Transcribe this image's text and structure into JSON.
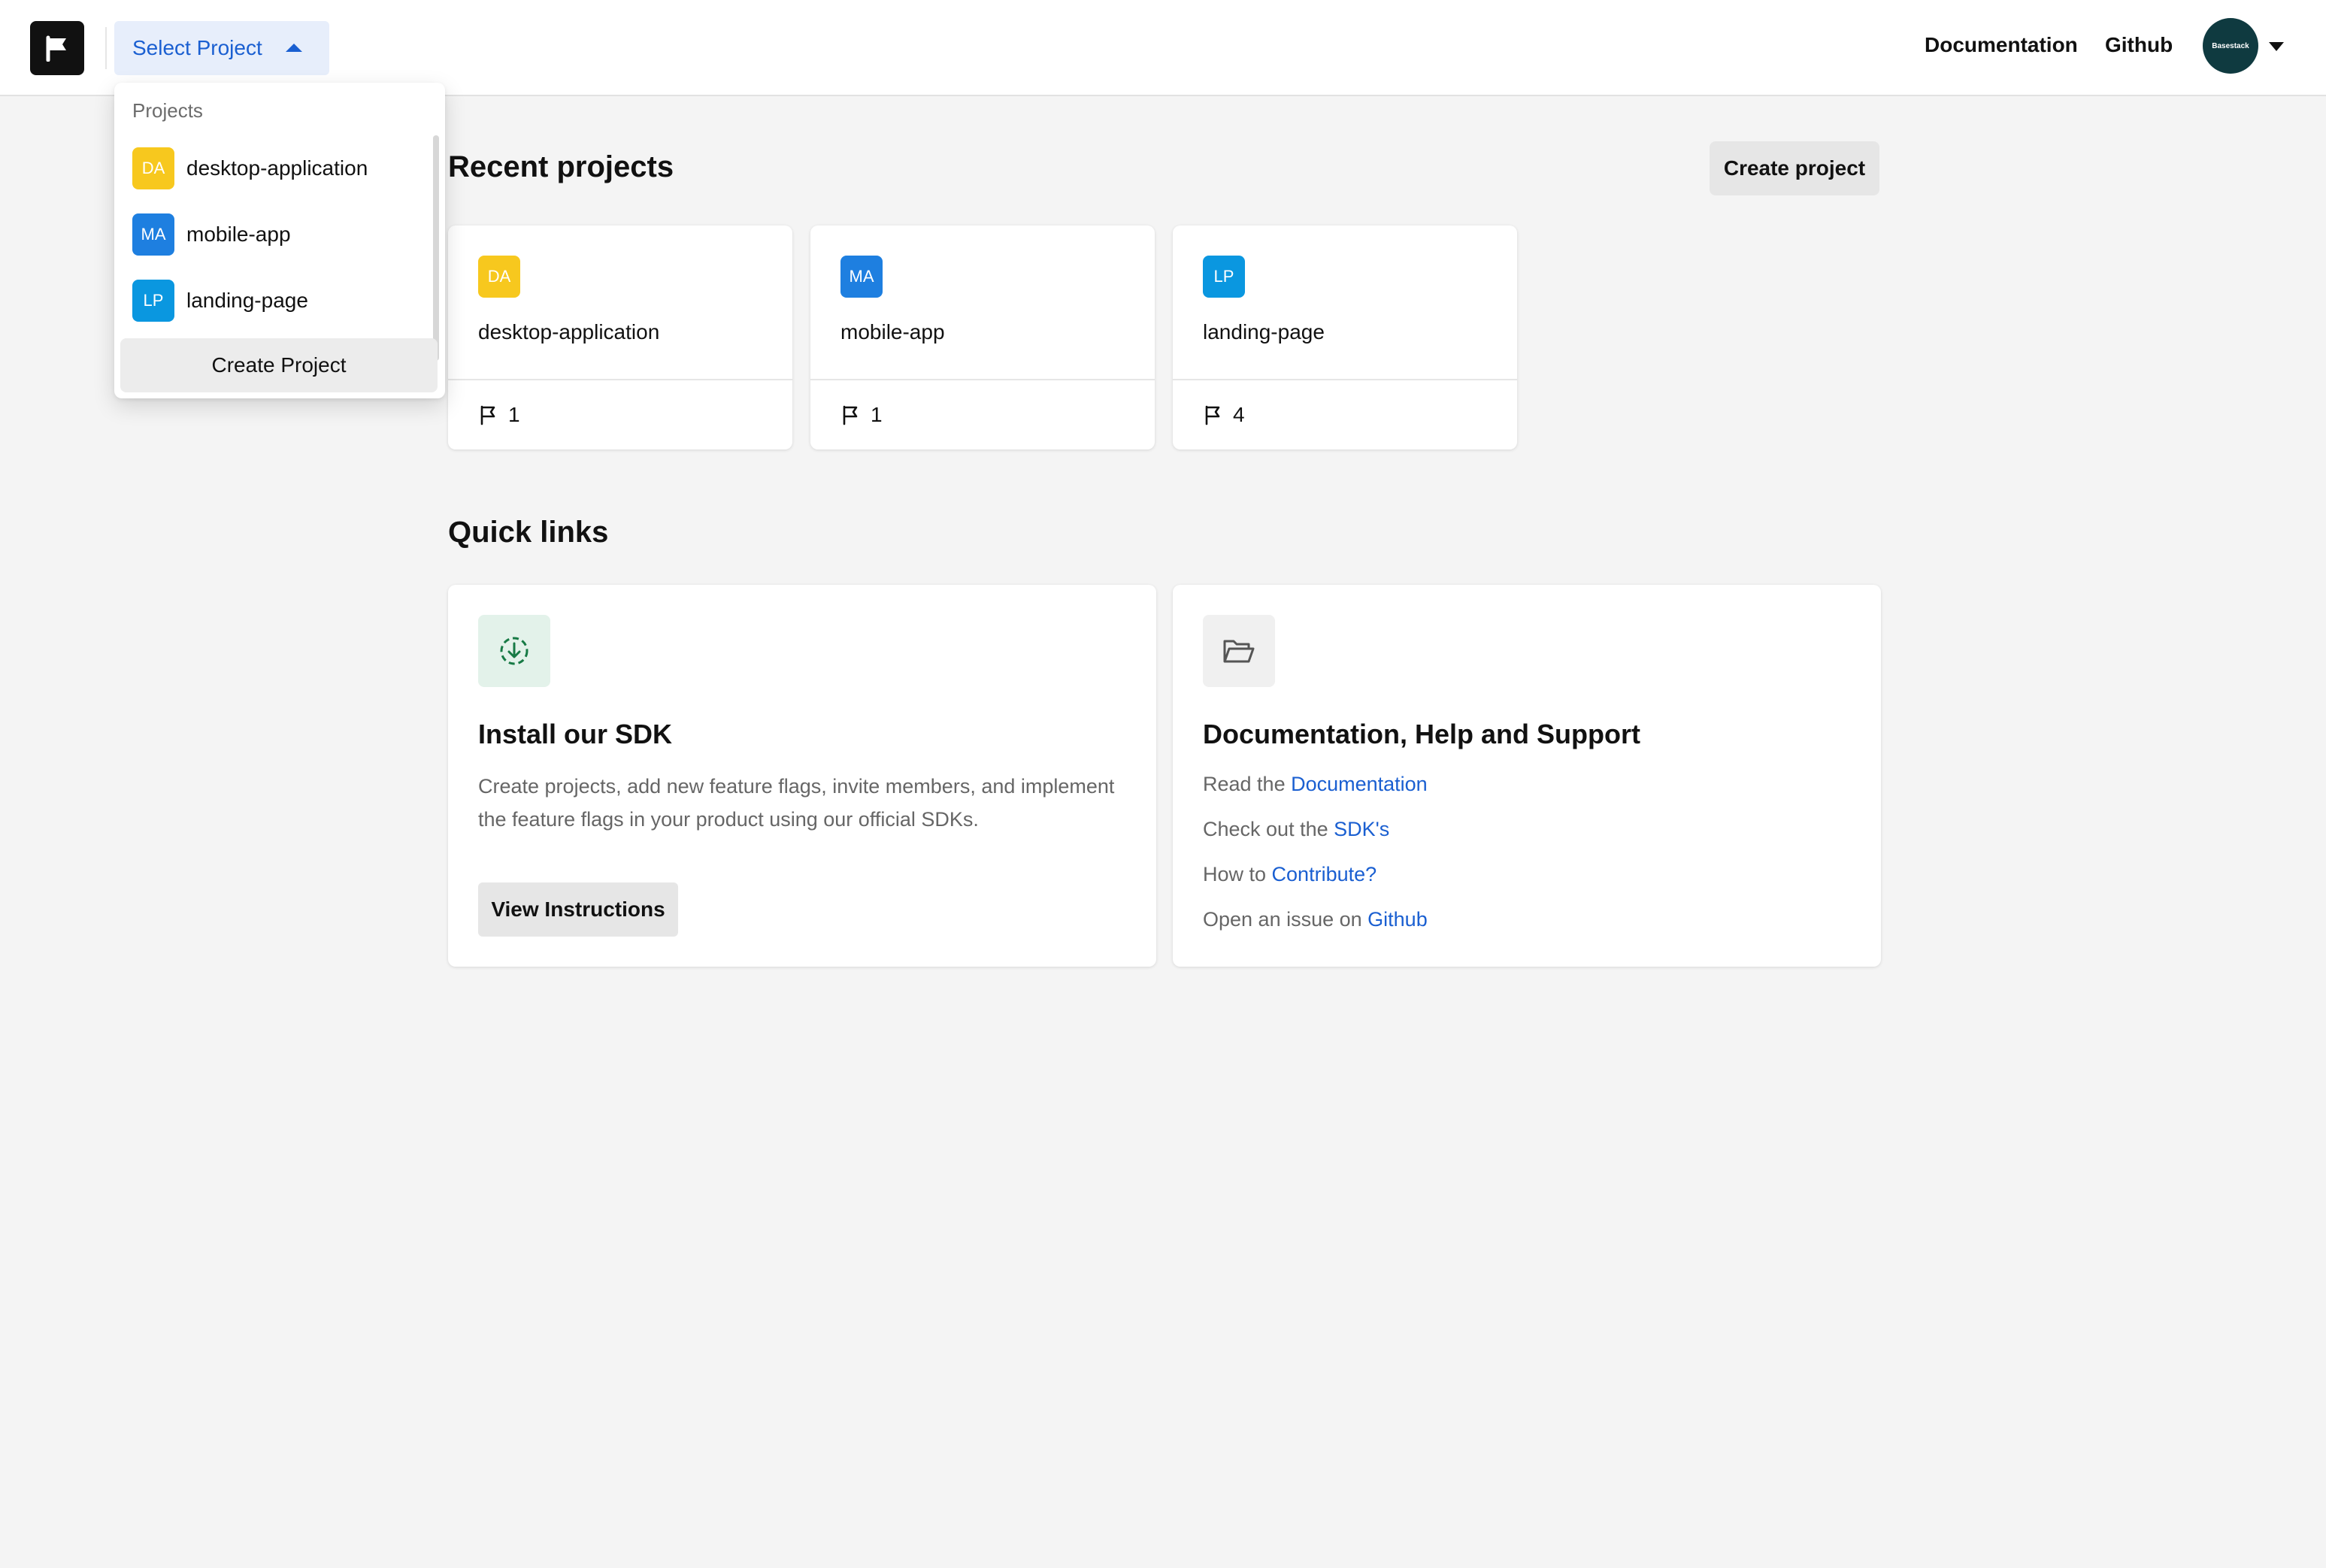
{
  "header": {
    "select_project_label": "Select Project",
    "nav_documentation": "Documentation",
    "nav_github": "Github",
    "avatar_text": "Basestack",
    "logo_icon": "flag-icon"
  },
  "dropdown": {
    "heading": "Projects",
    "items": [
      {
        "initials": "DA",
        "name": "desktop-application",
        "color": "#f7c81e"
      },
      {
        "initials": "MA",
        "name": "mobile-app",
        "color": "#1e7fe0"
      },
      {
        "initials": "LP",
        "name": "landing-page",
        "color": "#0a97e0"
      }
    ],
    "create_label": "Create Project"
  },
  "recent": {
    "title": "Recent projects",
    "create_button": "Create project",
    "projects": [
      {
        "initials": "DA",
        "name": "desktop-application",
        "flags": "1",
        "color": "#f7c81e"
      },
      {
        "initials": "MA",
        "name": "mobile-app",
        "flags": "1",
        "color": "#1e7fe0"
      },
      {
        "initials": "LP",
        "name": "landing-page",
        "flags": "4",
        "color": "#0a97e0"
      }
    ]
  },
  "quick_links": {
    "title": "Quick links",
    "sdk": {
      "icon": "download-circle-icon",
      "title": "Install our SDK",
      "description": "Create projects, add new feature flags, invite members, and implement the feature flags in your product using our official SDKs.",
      "button": "View Instructions"
    },
    "docs": {
      "icon": "folder-open-icon",
      "title": "Documentation, Help and Support",
      "lines": [
        {
          "prefix": "Read the ",
          "link": "Documentation"
        },
        {
          "prefix": "Check out the ",
          "link": "SDK's"
        },
        {
          "prefix": "How to ",
          "link": "Contribute?"
        },
        {
          "prefix": "Open an issue on ",
          "link": "Github"
        }
      ]
    }
  },
  "colors": {
    "accent": "#1a5fd1",
    "background": "#f4f4f4"
  }
}
